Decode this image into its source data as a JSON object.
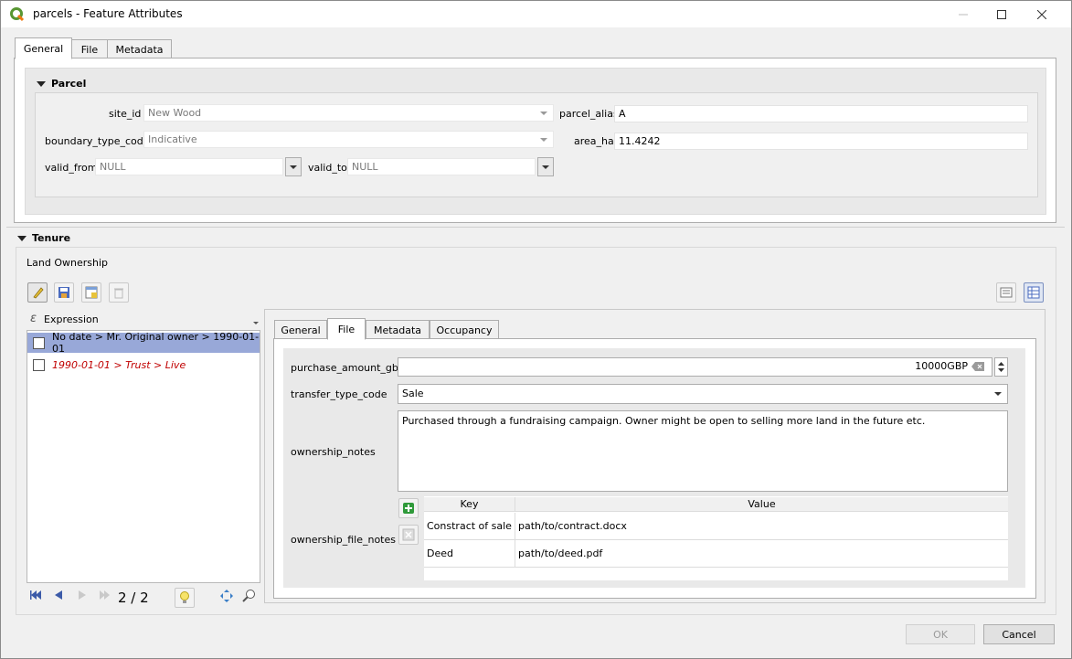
{
  "window": {
    "title": "parcels - Feature Attributes"
  },
  "tabs": {
    "general": "General",
    "file": "File",
    "metadata": "Metadata"
  },
  "parcel": {
    "title": "Parcel",
    "site_id_label": "site_id",
    "site_id_value": "New Wood",
    "parcel_alias_label": "parcel_alias",
    "parcel_alias_value": "A",
    "boundary_label": "boundary_type_code",
    "boundary_value": "Indicative",
    "area_label": "area_ha",
    "area_value": "11.4242",
    "valid_from_label": "valid_from",
    "valid_from_value": "NULL",
    "valid_to_label": "valid_to",
    "valid_to_value": "NULL"
  },
  "tenure": {
    "title": "Tenure",
    "subtitle": "Land Ownership",
    "expression_label": "Expression",
    "list": [
      {
        "text": "No date > Mr. Original owner > 1990-01-01",
        "selected": true
      },
      {
        "text": "1990-01-01 > Trust > Live",
        "selected": false
      }
    ],
    "page_indicator": "2 / 2"
  },
  "form_tabs": {
    "general": "General",
    "file": "File",
    "metadata": "Metadata",
    "occupancy": "Occupancy"
  },
  "form": {
    "purchase_label": "purchase_amount_gbp",
    "purchase_value": "10000GBP",
    "transfer_label": "transfer_type_code",
    "transfer_value": "Sale",
    "notes_label": "ownership_notes",
    "notes_value": "Purchased through a fundraising campaign. Owner might be open to selling more land in the future etc.",
    "file_notes_label": "ownership_file_notes",
    "kv_headers": {
      "key": "Key",
      "value": "Value"
    },
    "kv_rows": [
      {
        "key": "Constract of sale",
        "value": "path/to/contract.docx"
      },
      {
        "key": "Deed",
        "value": "path/to/deed.pdf"
      }
    ]
  },
  "buttons": {
    "ok": "OK",
    "cancel": "Cancel"
  },
  "colors": {
    "selection": "#98a8d8",
    "red_row_text": "#c00000",
    "nav_blue": "#3b5aa8"
  }
}
